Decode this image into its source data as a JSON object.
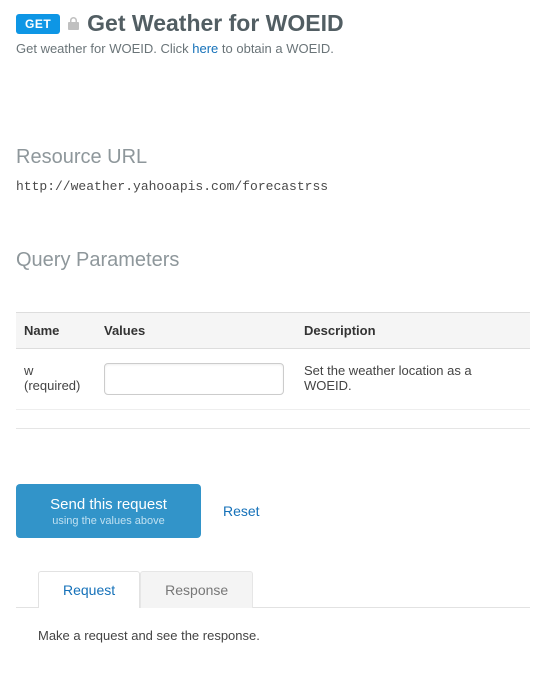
{
  "header": {
    "method_badge": "GET",
    "title": "Get Weather for WOEID"
  },
  "subtitle": {
    "prefix": "Get weather for WOEID. Click ",
    "link_text": "here",
    "suffix": " to obtain a WOEID."
  },
  "resource_url": {
    "heading": "Resource URL",
    "value": "http://weather.yahooapis.com/forecastrss"
  },
  "query_params": {
    "heading": "Query Parameters",
    "columns": {
      "name": "Name",
      "values": "Values",
      "description": "Description"
    },
    "rows": [
      {
        "name": "w",
        "required_label": "(required)",
        "value": "",
        "description": "Set the weather location as a WOEID."
      }
    ]
  },
  "actions": {
    "send_label": "Send this request",
    "send_sub": "using the values above",
    "reset_label": "Reset"
  },
  "tabs": {
    "request": "Request",
    "response": "Response"
  },
  "panel": {
    "message": "Make a request and see the response."
  }
}
